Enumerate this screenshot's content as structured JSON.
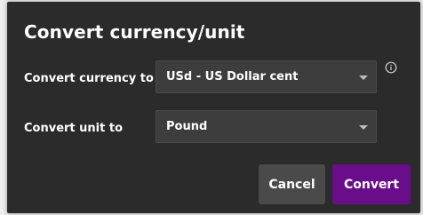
{
  "dialog": {
    "title": "Convert currency/unit",
    "currency_row": {
      "label": "Convert currency to",
      "selected": "USd - US Dollar cent"
    },
    "unit_row": {
      "label": "Convert unit to",
      "selected": "Pound"
    },
    "info_icon": "info-icon",
    "buttons": {
      "cancel_label": "Cancel",
      "convert_label": "Convert"
    },
    "colors": {
      "dialog_bg": "#2b2b2b",
      "select_bg": "#3d3d3d",
      "cancel_bg": "#4a4a4a",
      "convert_bg": "#6a0d8a"
    }
  }
}
